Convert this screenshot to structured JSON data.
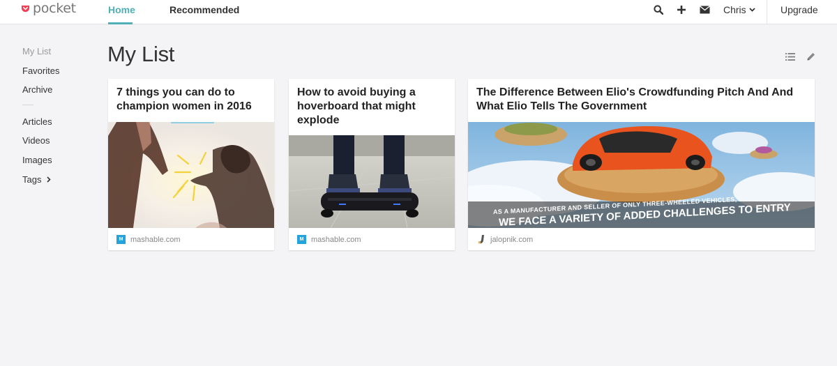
{
  "app": {
    "logo_text": "pocket",
    "brand_color": "#ef4056",
    "accent_color": "#4fb0b8"
  },
  "nav": {
    "home": "Home",
    "recommended": "Recommended"
  },
  "header": {
    "user": "Chris",
    "upgrade": "Upgrade",
    "icons": [
      "search-icon",
      "add-icon",
      "mail-icon",
      "chevron-down-icon"
    ]
  },
  "sidebar": {
    "items": [
      {
        "label": "My List"
      },
      {
        "label": "Favorites"
      },
      {
        "label": "Archive"
      },
      {
        "label": "Articles"
      },
      {
        "label": "Videos"
      },
      {
        "label": "Images"
      },
      {
        "label": "Tags"
      }
    ]
  },
  "main": {
    "title": "My List",
    "tools": [
      "list-view-icon",
      "edit-icon"
    ],
    "cards": [
      {
        "title": "7 things you can do to champion women in 2016",
        "source": "mashable.com",
        "favicon": "M"
      },
      {
        "title": "How to avoid buying a hoverboard that might explode",
        "source": "mashable.com",
        "favicon": "M"
      },
      {
        "title": "The Difference Between Elio's Crowdfunding Pitch And And What Elio Tells The Government",
        "source": "jalopnik.com",
        "favicon": "",
        "image_text_1": "AS A MANUFACTURER AND SELLER OF ONLY THREE-WHEELED VEHICLES,",
        "image_text_2": "WE FACE A VARIETY OF ADDED CHALLENGES TO ENTRY"
      }
    ]
  }
}
